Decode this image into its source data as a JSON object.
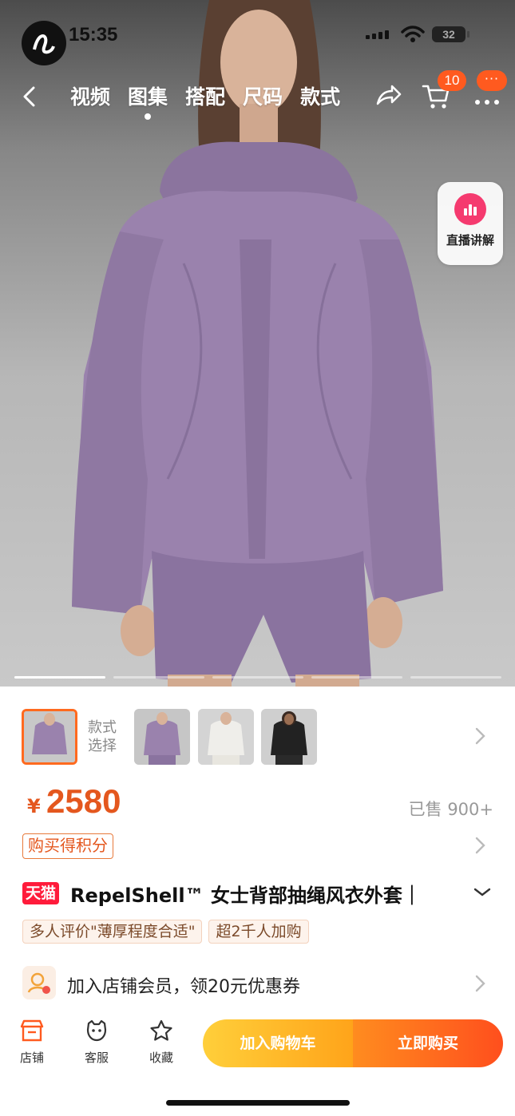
{
  "status_bar": {
    "time": "15:35",
    "battery": "32"
  },
  "nav": {
    "tabs": [
      {
        "label": "视频",
        "active": false
      },
      {
        "label": "图集",
        "active": true
      },
      {
        "label": "搭配",
        "active": false
      },
      {
        "label": "尺码",
        "active": false
      },
      {
        "label": "款式",
        "active": false
      }
    ],
    "cart_badge": "10",
    "more_badge": "···"
  },
  "live_button": {
    "label": "直播讲解"
  },
  "gallery": {
    "slide_count": 5,
    "current_index": 0
  },
  "styles": {
    "label": "款式选择",
    "thumb_count": 4,
    "selected_index": 0
  },
  "product": {
    "currency": "¥",
    "price": "2580",
    "sold": "已售 900+",
    "points_label": "购买得积分",
    "platform_badge": "天猫",
    "title": "RepelShell™ 女士背部抽绳风衣外套｜",
    "tags": [
      "多人评价\"薄厚程度合适\"",
      "超2千人加购"
    ],
    "member_text": "加入店铺会员，领20元优惠券"
  },
  "bottom_bar": {
    "store": "店铺",
    "service": "客服",
    "favorite": "收藏",
    "add_to_cart": "加入购物车",
    "buy_now": "立即购买"
  },
  "colors": {
    "accent_orange": "#e4571e",
    "badge_orange": "#ff5a1f",
    "tmall_red": "#ff1b3b",
    "jacket_purple": "#9a82ad"
  }
}
